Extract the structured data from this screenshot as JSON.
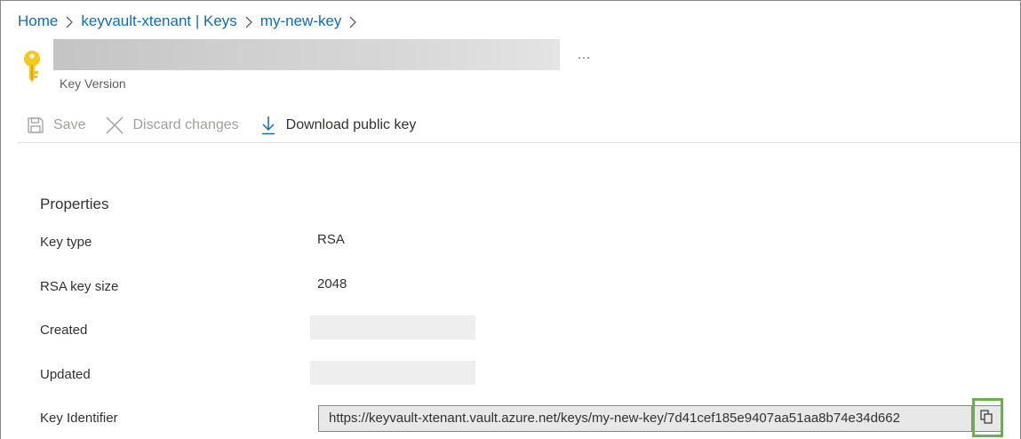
{
  "breadcrumb": {
    "items": [
      "Home",
      "keyvault-xtenant | Keys",
      "my-new-key"
    ]
  },
  "header": {
    "subtitle": "Key Version",
    "more_label": "…"
  },
  "toolbar": {
    "save_label": "Save",
    "discard_label": "Discard changes",
    "download_label": "Download public key"
  },
  "properties": {
    "section_title": "Properties",
    "key_type_label": "Key type",
    "key_type_value": "RSA",
    "key_size_label": "RSA key size",
    "key_size_value": "2048",
    "created_label": "Created",
    "updated_label": "Updated",
    "key_identifier_label": "Key Identifier",
    "key_identifier_value": "https://keyvault-xtenant.vault.azure.net/keys/my-new-key/7d41cef185e9407aa51aa8b74e34d662"
  },
  "colors": {
    "link": "#0f6cbd",
    "key_icon": "#f7c71c",
    "highlight": "#6ab04c"
  }
}
